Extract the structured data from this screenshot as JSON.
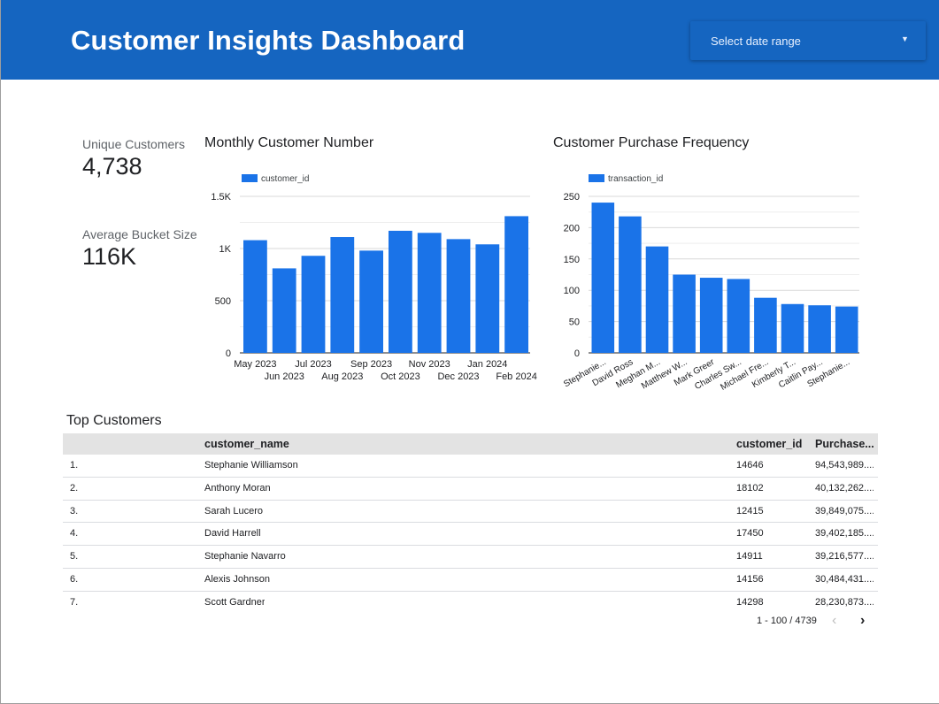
{
  "header": {
    "title": "Customer Insights Dashboard",
    "date_range_placeholder": "Select date range",
    "background_color": "#1565c0"
  },
  "kpis": [
    {
      "label": "Unique Customers",
      "value": "4,738"
    },
    {
      "label": "Average Bucket Size",
      "value": "116K"
    }
  ],
  "chart_data": [
    {
      "type": "bar",
      "title": "Monthly Customer Number",
      "legend": [
        "customer_id"
      ],
      "legend_position": "top-left",
      "categories": [
        "May 2023",
        "Jun 2023",
        "Jul 2023",
        "Aug 2023",
        "Sep 2023",
        "Oct 2023",
        "Nov 2023",
        "Dec 2023",
        "Jan 2024",
        "Feb 2024"
      ],
      "series": [
        {
          "name": "customer_id",
          "values": [
            1080,
            810,
            930,
            1110,
            980,
            1170,
            1150,
            1090,
            1040,
            1310
          ]
        }
      ],
      "ylim": [
        0,
        1500
      ],
      "yticks": [
        0,
        500,
        1000,
        1500
      ],
      "ytick_labels": [
        "0",
        "500",
        "1K",
        "1.5K"
      ],
      "grid": true,
      "color": "#1a73e8"
    },
    {
      "type": "bar",
      "title": "Customer Purchase Frequency",
      "legend": [
        "transaction_id"
      ],
      "legend_position": "top-left",
      "categories": [
        "Stephanie...",
        "David Ross",
        "Meghan M...",
        "Matthew W...",
        "Mark Greer",
        "Charles Sw...",
        "Michael Fre...",
        "Kimberly T...",
        "Caitlin Pay...",
        "Stephanie..."
      ],
      "series": [
        {
          "name": "transaction_id",
          "values": [
            240,
            218,
            170,
            125,
            120,
            118,
            88,
            78,
            76,
            74
          ]
        }
      ],
      "ylim": [
        0,
        250
      ],
      "yticks": [
        0,
        50,
        100,
        150,
        200,
        250
      ],
      "ytick_labels": [
        "0",
        "50",
        "100",
        "150",
        "200",
        "250"
      ],
      "grid": true,
      "color": "#1a73e8"
    }
  ],
  "table": {
    "title": "Top Customers",
    "columns": [
      "",
      "customer_name",
      "customer_id",
      "Purchase..."
    ],
    "rows": [
      {
        "idx": "1.",
        "name": "Stephanie Williamson",
        "id": "14646",
        "purchase": "94,543,989...."
      },
      {
        "idx": "2.",
        "name": "Anthony Moran",
        "id": "18102",
        "purchase": "40,132,262...."
      },
      {
        "idx": "3.",
        "name": "Sarah Lucero",
        "id": "12415",
        "purchase": "39,849,075...."
      },
      {
        "idx": "4.",
        "name": "David Harrell",
        "id": "17450",
        "purchase": "39,402,185...."
      },
      {
        "idx": "5.",
        "name": "Stephanie Navarro",
        "id": "14911",
        "purchase": "39,216,577...."
      },
      {
        "idx": "6.",
        "name": "Alexis Johnson",
        "id": "14156",
        "purchase": "30,484,431...."
      },
      {
        "idx": "7.",
        "name": "Scott Gardner",
        "id": "14298",
        "purchase": "28,230,873...."
      }
    ],
    "pagination": "1 - 100 / 4739",
    "prev_icon": "chevron-left-icon",
    "next_icon": "chevron-right-icon"
  }
}
